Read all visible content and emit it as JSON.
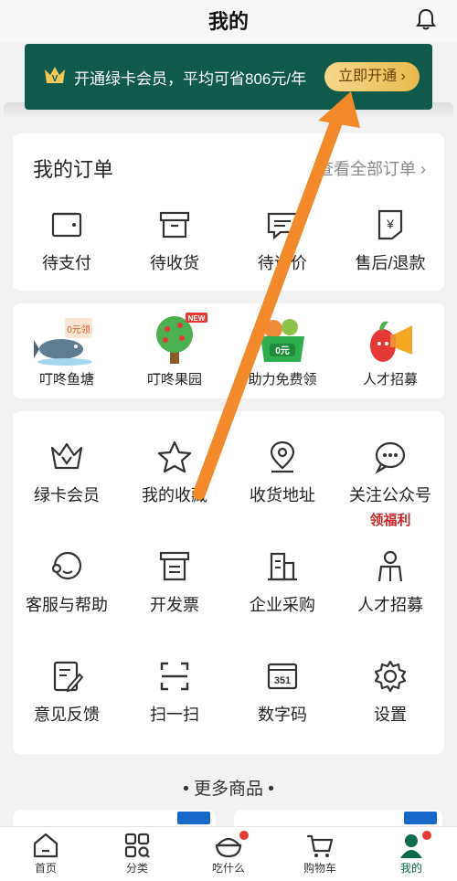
{
  "header": {
    "title": "我的"
  },
  "banner": {
    "text": "开通绿卡会员，平均可省806元/年",
    "button": "立即开通 ›"
  },
  "orders": {
    "title": "我的订单",
    "view_all": "查看全部订单 ›",
    "items": [
      {
        "label": "待支付",
        "icon": "wallet-icon"
      },
      {
        "label": "待收货",
        "icon": "box-icon"
      },
      {
        "label": "待评价",
        "icon": "comment-icon"
      },
      {
        "label": "售后/退款",
        "icon": "refund-icon"
      }
    ]
  },
  "fun": {
    "items": [
      {
        "label": "叮咚鱼塘",
        "icon": "fish-pond-icon",
        "badge": "0元领"
      },
      {
        "label": "叮咚果园",
        "icon": "fruit-tree-icon",
        "badge": "NEW"
      },
      {
        "label": "助力免费领",
        "icon": "free-basket-icon",
        "badge": "0元"
      },
      {
        "label": "人才招募",
        "icon": "megaphone-icon"
      }
    ]
  },
  "services": {
    "items": [
      {
        "label": "绿卡会员",
        "icon": "vip-crown-icon"
      },
      {
        "label": "我的收藏",
        "icon": "star-icon"
      },
      {
        "label": "收货地址",
        "icon": "location-icon"
      },
      {
        "label": "关注公众号",
        "icon": "chat-icon",
        "sub": "领福利"
      },
      {
        "label": "客服与帮助",
        "icon": "customer-service-icon"
      },
      {
        "label": "开发票",
        "icon": "invoice-icon"
      },
      {
        "label": "企业采购",
        "icon": "building-icon"
      },
      {
        "label": "人才招募",
        "icon": "recruit-icon"
      },
      {
        "label": "意见反馈",
        "icon": "feedback-icon"
      },
      {
        "label": "扫一扫",
        "icon": "scan-icon"
      },
      {
        "label": "数字码",
        "icon": "digital-code-icon"
      },
      {
        "label": "设置",
        "icon": "gear-icon"
      }
    ]
  },
  "more": {
    "title": "• 更多商品 •"
  },
  "tabbar": {
    "items": [
      {
        "label": "首页",
        "icon": "home-icon"
      },
      {
        "label": "分类",
        "icon": "category-icon"
      },
      {
        "label": "吃什么",
        "icon": "bowl-icon"
      },
      {
        "label": "购物车",
        "icon": "cart-icon"
      },
      {
        "label": "我的",
        "icon": "profile-icon"
      }
    ]
  },
  "colors": {
    "brand": "#0f5a4b",
    "accent": "#e9b94f",
    "arrow": "#f28a2b",
    "badge": "#c62828"
  }
}
